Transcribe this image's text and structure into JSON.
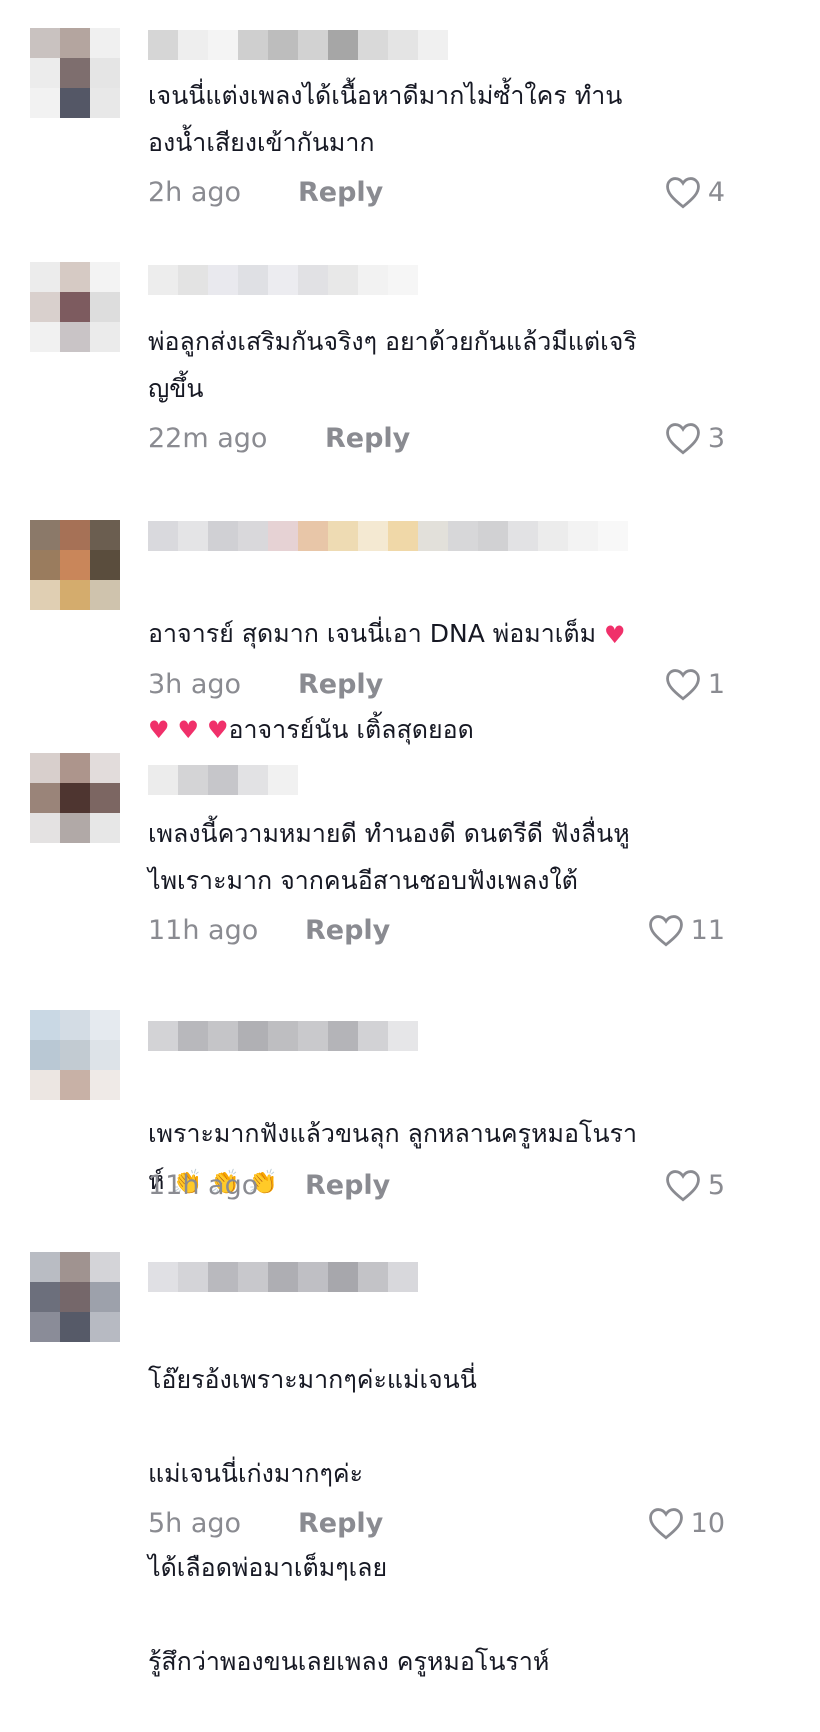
{
  "comments": [
    {
      "text": "เจนนี่แต่งเพลงได้เนื้อหาดีมากไม่ซ้ำใคร ทำน\nองน้ำเสียงเข้ากันมาก",
      "time": "2h ago",
      "reply": "Reply",
      "likes": "4",
      "avatar": [
        "#c9c2c0",
        "#b4a59f",
        "#f0f0f0",
        "#ececec",
        "#7e6e6e",
        "#e5e5e5",
        "#f2f2f2",
        "#545766",
        "#e8e8e8"
      ],
      "username_pixels": [
        "#d6d6d6",
        "#eeeeee",
        "#f4f4f4",
        "#cfcfcf",
        "#bdbdbd",
        "#d2d2d2",
        "#a6a6a6",
        "#d9d9d9",
        "#e4e4e4",
        "#f0f0f0"
      ]
    },
    {
      "text": "พ่อลูกส่งเสริมกันจริงๆ อยาด้วยกันแล้วมีแต่เจริ\nญขึ้น",
      "time": "22m ago",
      "reply": "Reply",
      "likes": "3",
      "avatar": [
        "#ececec",
        "#d6cac4",
        "#f3f3f3",
        "#d9d0cd",
        "#7d5b5f",
        "#dddddd",
        "#f1f1f1",
        "#c9c4c6",
        "#ebebeb"
      ],
      "username_pixels": [
        "#ededed",
        "#e3e3e3",
        "#e9e9ee",
        "#dfe0e4",
        "#ececf0",
        "#e1e1e4",
        "#e8e8e8",
        "#f2f2f2",
        "#f6f6f6",
        "#ffffff"
      ]
    },
    {
      "text": "อาจารย์ สุดมาก เจนนี่เอา DNA พ่อมาเต็ม ",
      "text2_suffix": "อาจารย์นัน เติ้ลสุดยอด",
      "time": "3h ago",
      "reply": "Reply",
      "likes": "1",
      "avatar": [
        "#8b7969",
        "#a67156",
        "#6b5e50",
        "#9a7c5e",
        "#c9865a",
        "#5a4d3d",
        "#e0cfb3",
        "#d4ac6d",
        "#cfc3ad"
      ],
      "username_pixels": [
        "#d9d9dd",
        "#e4e4e6",
        "#d0d0d4",
        "#d9d8db",
        "#e6d2d4",
        "#e8c6a8",
        "#eedbb3",
        "#f4e9d2",
        "#f0d8a8",
        "#e2e0da",
        "#d7d7d9",
        "#d1d1d3",
        "#e2e2e4",
        "#ececec",
        "#f3f3f3",
        "#f8f8f8"
      ]
    },
    {
      "text": "เพลงนี้ความหมายดี ทำนองดี ดนตรีดี ฟังลื่นหู\nไพเราะมาก จากคนอีสานชอบฟังเพลงใต้",
      "time": "11h ago",
      "reply": "Reply",
      "likes": "11",
      "avatar": [
        "#d8cfcc",
        "#ad958c",
        "#e2dcdb",
        "#9a8479",
        "#4e3530",
        "#7c6662",
        "#e4e2e2",
        "#b1a9a7",
        "#e7e7e7"
      ],
      "username_pixels": [
        "#ececec",
        "#d4d4d6",
        "#c6c6ca",
        "#e2e2e4",
        "#f1f1f1"
      ]
    },
    {
      "text": "เพราะมากฟังแล้วขนลุก ลูกหลานครูหมอโนรา\nห์ ",
      "time": "11h ago",
      "reply": "Reply",
      "likes": "5",
      "avatar": [
        "#c9d8e4",
        "#d3dce4",
        "#e5eaef",
        "#b9c8d4",
        "#c2cbd2",
        "#dde3e8",
        "#ece6e2",
        "#c8b1a6",
        "#efeae7"
      ],
      "username_pixels": [
        "#d3d3d6",
        "#b8b8bc",
        "#c5c5c8",
        "#b0b0b4",
        "#bebec1",
        "#c9c9cc",
        "#b4b4b8",
        "#d2d2d5",
        "#e6e6e8"
      ]
    },
    {
      "lines": [
        "โอ๊ยรอ้งเพราะมากๆค่ะแม่เจนนี่",
        "แม่เจนนี่เก่งมากๆค่ะ",
        "ได้เลือดพ่อมาเต็มๆเลย",
        "รู้สึกว่าพองขนเลยเพลง ครูหมอโนราห์"
      ],
      "time": "5h ago",
      "reply": "Reply",
      "likes": "10",
      "avatar": [
        "#b9bcc3",
        "#a09390",
        "#d4d4d8",
        "#6c6f7c",
        "#75676a",
        "#9da1ab",
        "#8a8c98",
        "#565a68",
        "#b7bac2"
      ],
      "username_pixels": [
        "#e0e0e4",
        "#d4d4d8",
        "#b9b9be",
        "#c8c8cc",
        "#aeaeb3",
        "#bfbfc4",
        "#a7a7ac",
        "#c3c3c7",
        "#d8d8dc"
      ]
    }
  ],
  "emoji": {
    "heart": "♥",
    "clap": "👏"
  },
  "colors": {
    "text": "#161823",
    "muted": "#8a8b91",
    "heart_emoji": "#f0306a",
    "clap_emoji": "#f2a33a"
  },
  "icons": {
    "like": "heart-outline-icon"
  }
}
